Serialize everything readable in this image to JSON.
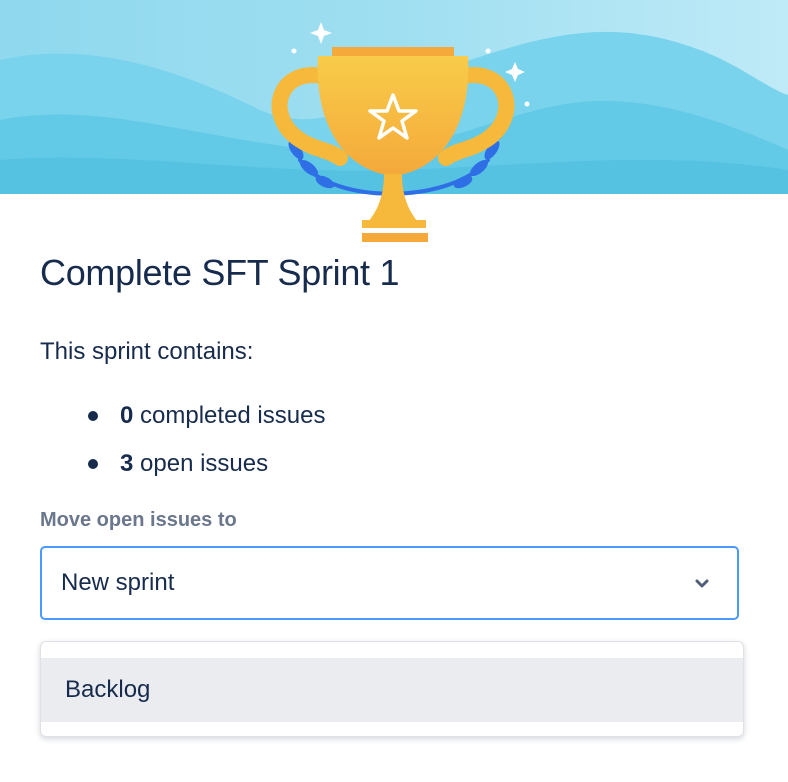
{
  "dialog": {
    "title": "Complete SFT Sprint 1",
    "contains_text": "This sprint contains:",
    "issues": [
      {
        "count": "0",
        "label": " completed issues"
      },
      {
        "count": "3",
        "label": " open issues"
      }
    ],
    "move_label": "Move open issues to",
    "select": {
      "value": "New sprint",
      "options": [
        "Backlog"
      ]
    }
  },
  "colors": {
    "sky_light": "#bfeaf7",
    "sky": "#79d3ec",
    "sky_dark": "#4fc0e0",
    "trophy_gold": "#f6b93b",
    "trophy_light": "#f9cc4a",
    "laurel_blue": "#2f6fe6",
    "text": "#172b4d",
    "label": "#6b778c",
    "focus_border": "#4c9aff",
    "option_hover": "#ebecf0"
  },
  "icons": {
    "hero": "trophy-icon",
    "select": "chevron-down-icon"
  }
}
